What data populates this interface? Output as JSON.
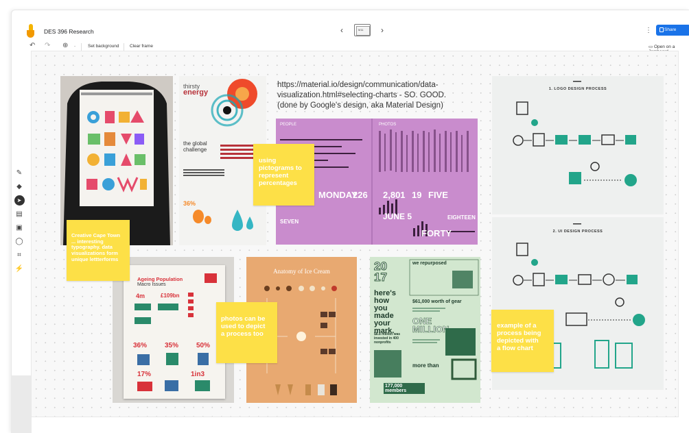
{
  "app": {
    "title": "DES 396 Research",
    "frame_indicator": "5/11",
    "share_label": "Share",
    "open_jamboard": "Open on a Jamboard"
  },
  "toolbar": {
    "set_background": "Set background",
    "clear_frame": "Clear frame",
    "zoom_label": "-"
  },
  "stickies": [
    "Creative Cape Town\n... interesting\ntypography. data\nvisualizations form\nunique lettterforms",
    "using\npictograms to\nrepresent\npercentages",
    "photos can be\nused to depict\na process too",
    "example of a\nprocess being\ndepicted with\na flow chart"
  ],
  "url_note": "https://material.io/design/communication/data-visualization.html#selecting-charts - SO. GOOD. (done by Google's design, aka Material Design)",
  "images": {
    "thirsty": {
      "title1": "thirsty",
      "title2": "energy",
      "section": "the global challenge",
      "pct": "36%"
    },
    "purple": {
      "col1": "PEOPLE",
      "col2": "PHOTOS",
      "n1": "MONDAY",
      "n2": "226",
      "n3": "2,801",
      "n4": "19",
      "n5": "FIVE",
      "n6": "JUNE 5",
      "n7": "EIGHTEEN",
      "n8": "FORTY",
      "n9": "SEVEN"
    },
    "process1": {
      "title": "1. LOGO DESIGN PROCESS"
    },
    "process2": {
      "title": "2. UI DESIGN PROCESS"
    },
    "ageing": {
      "title": "Ageing Population",
      "subtitle": "Macro Issues",
      "s1": "4m",
      "s2": "£109bn",
      "s3": "36%",
      "s4": "35%",
      "s5": "50%",
      "s6": "17%",
      "s7": "1in3"
    },
    "icecream": {
      "title": "Anatomy of Ice Cream"
    },
    "green": {
      "year1": "20",
      "year2": "17",
      "head": "here's how you made your mark.",
      "r1": "we repurposed",
      "r2": "$61,000 worth of gear",
      "r3": "ONE MILLION",
      "r4": "more than",
      "r5": "177,000 members",
      "r6": "$8.8 million was invested in 400 nonprofits"
    }
  },
  "colors": {
    "sticky": "#fde047",
    "share": "#1a73e8",
    "purple": "#c98ccd",
    "green": "#cfe8cf",
    "teal": "#22a58a"
  }
}
